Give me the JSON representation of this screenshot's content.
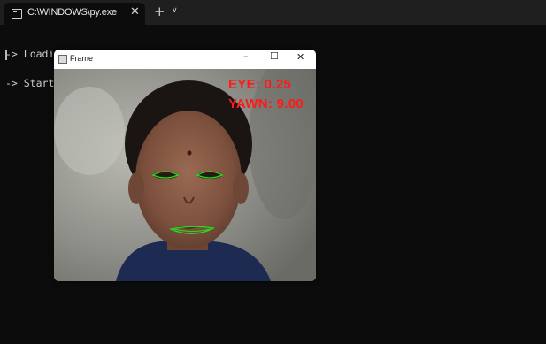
{
  "terminal": {
    "tab_title": "C:\\WINDOWS\\py.exe",
    "lines": [
      "-> Loading the predictor and detector...",
      "-> Starting Video Stream"
    ]
  },
  "frame_window": {
    "title": "Frame",
    "minimize": "–",
    "maximize": "☐",
    "close": "✕",
    "overlay": {
      "eye": "EYE: 0.25",
      "yawn": "YAWN: 9.00"
    }
  },
  "colors": {
    "terminal_bg": "#0c0c0c",
    "overlay_text": "#ff1a1a",
    "landmark": "#22dd22"
  }
}
